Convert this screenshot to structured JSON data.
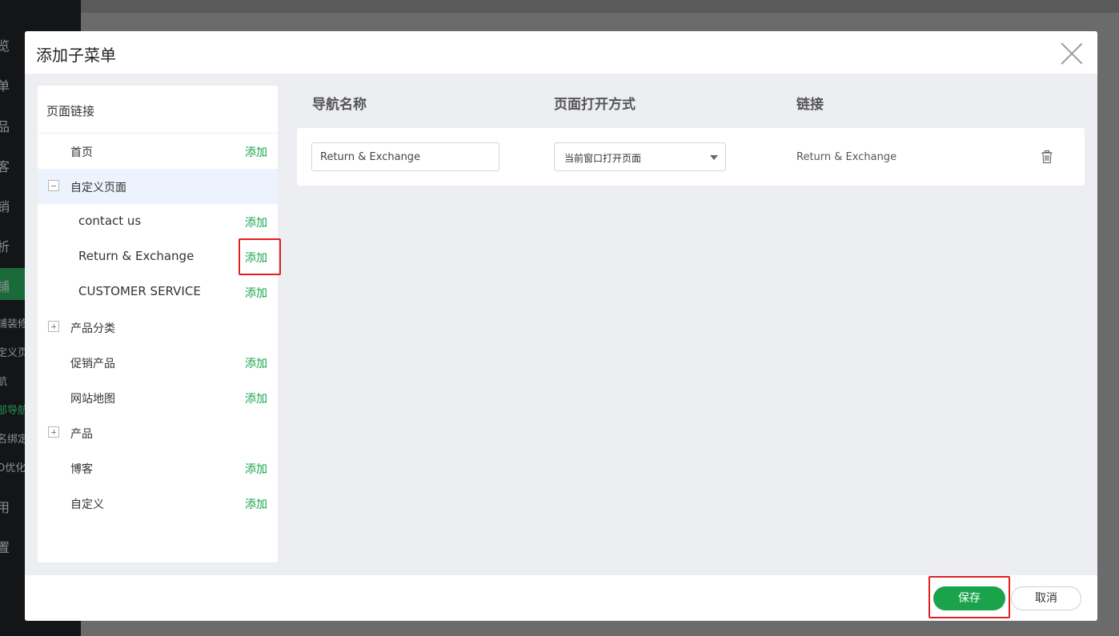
{
  "background": {
    "sidebar_items": [
      {
        "label": "览",
        "style": "normal"
      },
      {
        "label": "单",
        "style": "normal"
      },
      {
        "label": "品",
        "style": "normal"
      },
      {
        "label": "客",
        "style": "normal"
      },
      {
        "label": "销",
        "style": "normal"
      },
      {
        "label": "析",
        "style": "normal"
      },
      {
        "label": "铺",
        "style": "active"
      },
      {
        "label": "铺装修",
        "style": "small"
      },
      {
        "label": "定义页",
        "style": "small"
      },
      {
        "label": "航",
        "style": "small"
      },
      {
        "label": "部导航",
        "style": "small-green"
      },
      {
        "label": "名绑定",
        "style": "small"
      },
      {
        "label": "O优化",
        "style": "small"
      },
      {
        "label": "用",
        "style": "normal"
      },
      {
        "label": "置",
        "style": "normal"
      }
    ]
  },
  "modal": {
    "title": "添加子菜单",
    "left_panel": {
      "title": "页面链接",
      "add_label": "添加",
      "items": [
        {
          "label": "首页",
          "level": 0,
          "toggle": "none",
          "has_add": true
        },
        {
          "label": "自定义页面",
          "level": 0,
          "toggle": "minus",
          "has_add": false,
          "selected": true
        },
        {
          "label": "contact us",
          "level": 1,
          "toggle": "none",
          "has_add": true
        },
        {
          "label": "Return & Exchange",
          "level": 1,
          "toggle": "none",
          "has_add": true
        },
        {
          "label": "CUSTOMER SERVICE",
          "level": 1,
          "toggle": "none",
          "has_add": true
        },
        {
          "label": "产品分类",
          "level": 0,
          "toggle": "plus",
          "has_add": false
        },
        {
          "label": "促销产品",
          "level": 0,
          "toggle": "none",
          "has_add": true
        },
        {
          "label": "网站地图",
          "level": 0,
          "toggle": "none",
          "has_add": true
        },
        {
          "label": "产品",
          "level": 0,
          "toggle": "plus",
          "has_add": false
        },
        {
          "label": "博客",
          "level": 0,
          "toggle": "none",
          "has_add": true
        },
        {
          "label": "自定义",
          "level": 0,
          "toggle": "none",
          "has_add": true
        }
      ]
    },
    "columns": {
      "name": "导航名称",
      "open_mode": "页面打开方式",
      "link": "链接"
    },
    "row": {
      "name_value": "Return & Exchange",
      "open_mode_value": "当前窗口打开页面",
      "link_value": "Return & Exchange",
      "delete_icon": "trash-icon"
    },
    "footer": {
      "save_label": "保存",
      "cancel_label": "取消"
    }
  },
  "colors": {
    "accent_green": "#1aa34a",
    "highlight_red": "#e02020"
  }
}
